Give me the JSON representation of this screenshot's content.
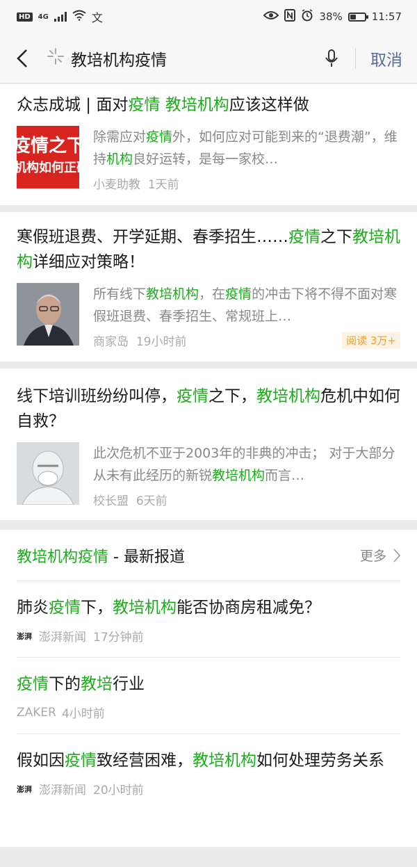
{
  "statusbar": {
    "network": "4G",
    "hd": "HD",
    "battery": "38%",
    "battery_level": 0.38,
    "time": "11:57"
  },
  "search": {
    "query": "教培机构疫情",
    "cancel": "取消"
  },
  "articles": [
    {
      "title_parts": [
        "众志成城 | 面对",
        "疫情",
        " ",
        "教培机构",
        "应该这样做"
      ],
      "snippet_parts": [
        "除需应对",
        "疫情",
        "外，如何应对可能到来的“退费潮”，维持",
        "机构",
        "良好运转，是每一家校…"
      ],
      "thumb_text_1": "疫情之下",
      "thumb_text_2": "机构如何正确",
      "source": "小麦助教",
      "time": "1天前"
    },
    {
      "title_parts": [
        "寒假班退费、开学延期、春季招生……",
        "疫情",
        "之下",
        "教培机构",
        "详细应对策略！"
      ],
      "snippet_parts": [
        "所有线下",
        "教培机构",
        "，在",
        "疫情",
        "的冲击下将不得不面对寒假班退费、春季招生、常规班上…"
      ],
      "source": "商家岛",
      "time": "19小时前",
      "read_badge": "阅读 3万+"
    },
    {
      "title_parts": [
        "线下培训班纷纷叫停，",
        "疫情",
        "之下，",
        "教培机构",
        "危机中如何自救？"
      ],
      "snippet_parts": [
        "此次危机不亚于2003年的非典的冲击； 对于大部分从未有此经历的新锐",
        "教培机构",
        "而言…"
      ],
      "source": "校长盟",
      "time": "6天前"
    }
  ],
  "news": {
    "header_parts": [
      "教培机构疫情",
      " - 最新报道"
    ],
    "more": "更多",
    "items": [
      {
        "title_parts": [
          "肺炎",
          "疫情",
          "下，",
          "教培机构",
          "能否协商房租减免？"
        ],
        "logo": "澎湃",
        "source": "澎湃新闻",
        "time": "17分钟前"
      },
      {
        "title_parts": [
          "疫情",
          "下的",
          "教培",
          "行业"
        ],
        "logo": "",
        "source": "ZAKER",
        "time": "4小时前"
      },
      {
        "title_parts": [
          "假如因",
          "疫情",
          "致经营困难，",
          "教培机构",
          "如何处理劳务关系"
        ],
        "logo": "澎湃",
        "source": "澎湃新闻",
        "time": "20小时前"
      }
    ]
  },
  "colors": {
    "highlight": "#1aad19",
    "link": "#576b95",
    "meta": "#aaaaaa"
  }
}
